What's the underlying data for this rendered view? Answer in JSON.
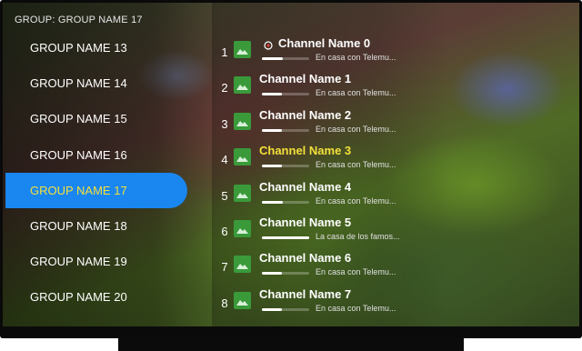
{
  "header": {
    "group_label": "GROUP: GROUP NAME 17"
  },
  "groups": [
    {
      "label": "GROUP NAME 13"
    },
    {
      "label": "GROUP NAME 14"
    },
    {
      "label": "GROUP NAME 15"
    },
    {
      "label": "GROUP NAME 16"
    },
    {
      "label": "GROUP NAME 17",
      "selected": true
    },
    {
      "label": "GROUP NAME 18"
    },
    {
      "label": "GROUP NAME 19"
    },
    {
      "label": "GROUP NAME 20"
    }
  ],
  "channels": [
    {
      "number": "1",
      "name": "Channel Name 0",
      "program": "En casa con Telemu...",
      "progress": 0.45,
      "icon": "clock-icon"
    },
    {
      "number": "2",
      "name": "Channel Name 1",
      "program": "En casa con Telemu...",
      "progress": 0.42
    },
    {
      "number": "3",
      "name": "Channel Name 2",
      "program": "En casa con Telemu...",
      "progress": 0.42
    },
    {
      "number": "4",
      "name": "Channel Name 3",
      "program": "En casa con Telemu...",
      "progress": 0.42,
      "active": true
    },
    {
      "number": "5",
      "name": "Channel Name 4",
      "program": "En casa con Telemu...",
      "progress": 0.45
    },
    {
      "number": "6",
      "name": "Channel Name 5",
      "program": "La casa de los famos...",
      "progress": 1.0
    },
    {
      "number": "7",
      "name": "Channel Name 6",
      "program": "En casa con Telemu...",
      "progress": 0.42
    },
    {
      "number": "8",
      "name": "Channel Name 7",
      "program": "En casa con Telemu...",
      "progress": 0.42
    }
  ],
  "colors": {
    "accent": "#1a86f0",
    "highlight_text": "#f2e03a",
    "thumbnail": "#3a9a3a"
  }
}
